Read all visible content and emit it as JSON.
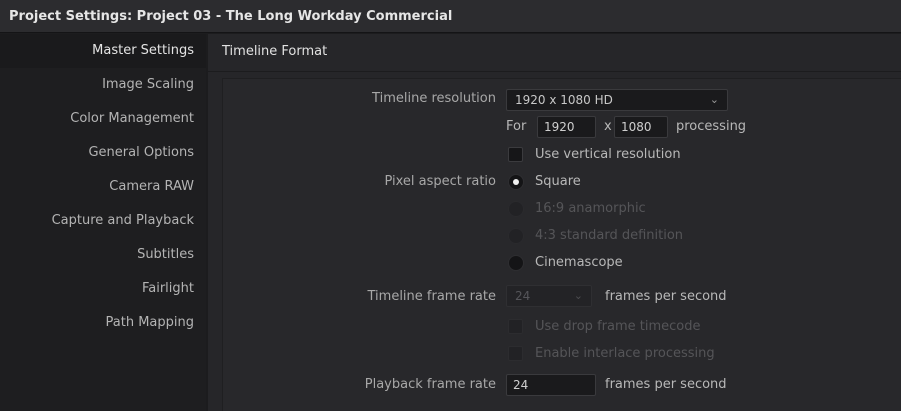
{
  "window": {
    "title": "Project Settings:  Project 03 - The Long Workday Commercial"
  },
  "sidebar": {
    "items": [
      {
        "label": "Master Settings",
        "active": true
      },
      {
        "label": "Image Scaling"
      },
      {
        "label": "Color Management"
      },
      {
        "label": "General Options"
      },
      {
        "label": "Camera RAW"
      },
      {
        "label": "Capture and Playback"
      },
      {
        "label": "Subtitles"
      },
      {
        "label": "Fairlight"
      },
      {
        "label": "Path Mapping"
      }
    ]
  },
  "section": {
    "title": "Timeline Format"
  },
  "timeline_resolution": {
    "label": "Timeline resolution",
    "value": "1920 x 1080 HD",
    "for_label": "For",
    "width": "1920",
    "x_label": "x",
    "height": "1080",
    "processing_label": "processing",
    "vertical_label": "Use vertical resolution",
    "vertical_checked": false
  },
  "pixel_aspect": {
    "label": "Pixel aspect ratio",
    "options": [
      {
        "label": "Square",
        "checked": true,
        "enabled": true
      },
      {
        "label": "16:9 anamorphic",
        "checked": false,
        "enabled": false
      },
      {
        "label": "4:3 standard definition",
        "checked": false,
        "enabled": false
      },
      {
        "label": "Cinemascope",
        "checked": false,
        "enabled": true
      }
    ]
  },
  "timeline_frame_rate": {
    "label": "Timeline frame rate",
    "value": "24",
    "unit": "frames per second",
    "drop_frame_label": "Use drop frame timecode",
    "interlace_label": "Enable interlace processing"
  },
  "playback_frame_rate": {
    "label": "Playback frame rate",
    "value": "24",
    "unit": "frames per second"
  },
  "icons": {
    "dropdown": "chevron-down-icon"
  }
}
